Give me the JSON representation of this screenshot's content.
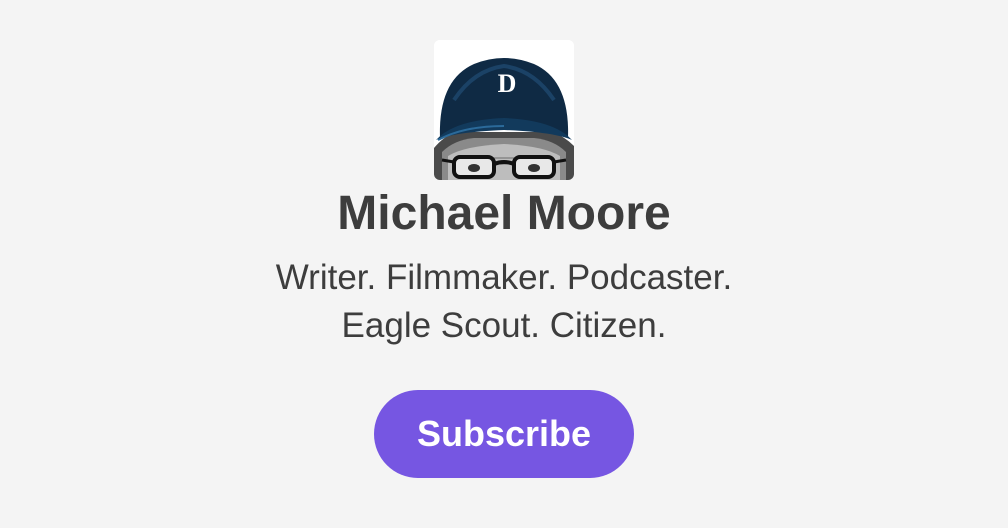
{
  "profile": {
    "name": "Michael Moore",
    "tagline_line1": "Writer. Filmmaker. Podcaster.",
    "tagline_line2": "Eagle Scout. Citizen.",
    "avatar_icon": "portrait-illustration-icon",
    "cap_logo_letter": "D"
  },
  "actions": {
    "subscribe_label": "Subscribe"
  },
  "colors": {
    "background": "#f4f4f4",
    "text": "#3d3d3d",
    "accent": "#7656e2",
    "button_text": "#ffffff"
  }
}
